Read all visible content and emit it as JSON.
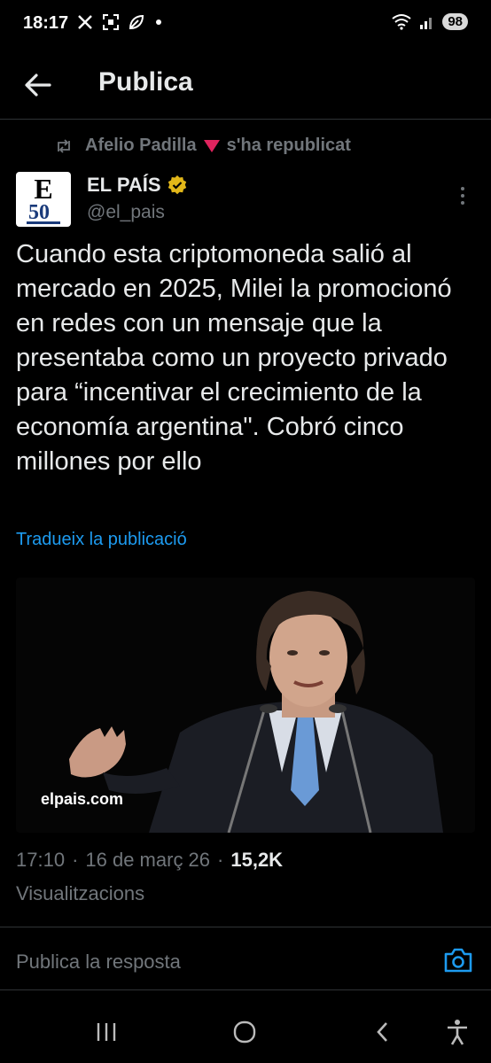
{
  "status_bar": {
    "time": "18:17",
    "battery": "98"
  },
  "header": {
    "title": "Publica"
  },
  "repost": {
    "user": "Afelio Padilla",
    "suffix": "s'ha republicat"
  },
  "author": {
    "name": "EL PAÍS",
    "handle": "@el_pais",
    "avatar_letter": "E",
    "avatar_number": "50"
  },
  "post": {
    "text": "Cuando esta criptomoneda salió al mercado en 2025, Milei la promocionó en redes con un mensaje que la presentaba como un proyecto privado para “incentivar el crecimiento de la economía argentina\". Cobró cinco millones por ello",
    "translate_link": "Tradueix la publicació",
    "image_watermark": "elpais.com"
  },
  "meta": {
    "time": "17:10",
    "date": "16 de març 26",
    "views": "15,2K",
    "views_label": "Visualitzacions"
  },
  "reply": {
    "placeholder": "Publica la resposta"
  },
  "colors": {
    "background": "#000000",
    "text": "#e7e9ea",
    "muted": "#71767b",
    "link": "#1d9bf0",
    "verified": "#e2b719"
  }
}
